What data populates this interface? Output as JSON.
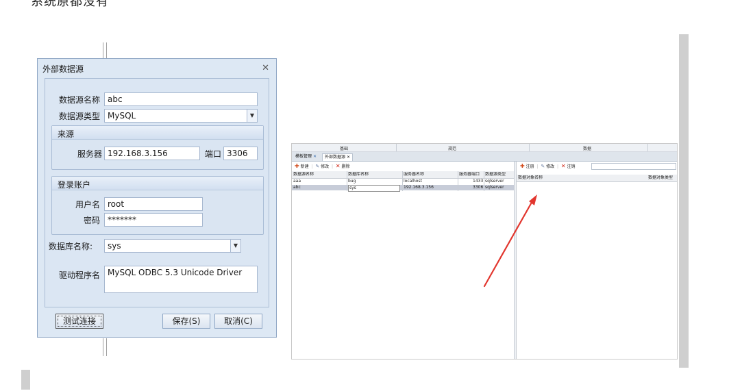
{
  "top_text": "系统原都没有",
  "dialog": {
    "title": "外部数据源",
    "fields": {
      "datasource_name_label": "数据源名称",
      "datasource_name_value": "abc",
      "datasource_type_label": "数据源类型",
      "datasource_type_value": "MySQL"
    },
    "source_group": {
      "title": "来源",
      "server_label": "服务器",
      "server_value": "192.168.3.156",
      "port_label": "端口",
      "port_value": "3306"
    },
    "login_group": {
      "title": "登录账户",
      "user_label": "用户名",
      "user_value": "root",
      "password_label": "密码",
      "password_value": "*******"
    },
    "database_label": "数据库名称:",
    "database_value": "sys",
    "driver_label": "驱动程序名",
    "driver_value": "MySQL ODBC 5.3 Unicode Driver",
    "buttons": {
      "test": "测试连接",
      "save": "保存(S)",
      "cancel": "取消(C)"
    }
  },
  "app": {
    "ribbon": [
      "基础",
      "规范",
      "数据"
    ],
    "tabs": [
      {
        "label": "模板管理",
        "active": false
      },
      {
        "label": "外部数据源",
        "active": true
      }
    ],
    "left_toolbar": {
      "new": "新建",
      "edit": "修改",
      "delete": "删除"
    },
    "right_toolbar": {
      "register": "注册",
      "edit": "修改",
      "unregister": "注销"
    },
    "left_grid": {
      "columns": [
        "数据源名称",
        "数据库名称",
        "服务器名称",
        "服务器端口",
        "数据源类型"
      ],
      "rows": [
        [
          "aaa",
          "bug",
          "localhost",
          "1433",
          "sqlserver"
        ],
        [
          "abc",
          "sys",
          "192.168.3.156",
          "3306",
          "sqlserver"
        ]
      ],
      "selected_row": 1
    },
    "right_grid": {
      "columns": [
        "数据对象名称",
        "数据对象类型"
      ]
    }
  },
  "colors": {
    "arrow": "#e2362e",
    "accent": "#dde8f4"
  }
}
